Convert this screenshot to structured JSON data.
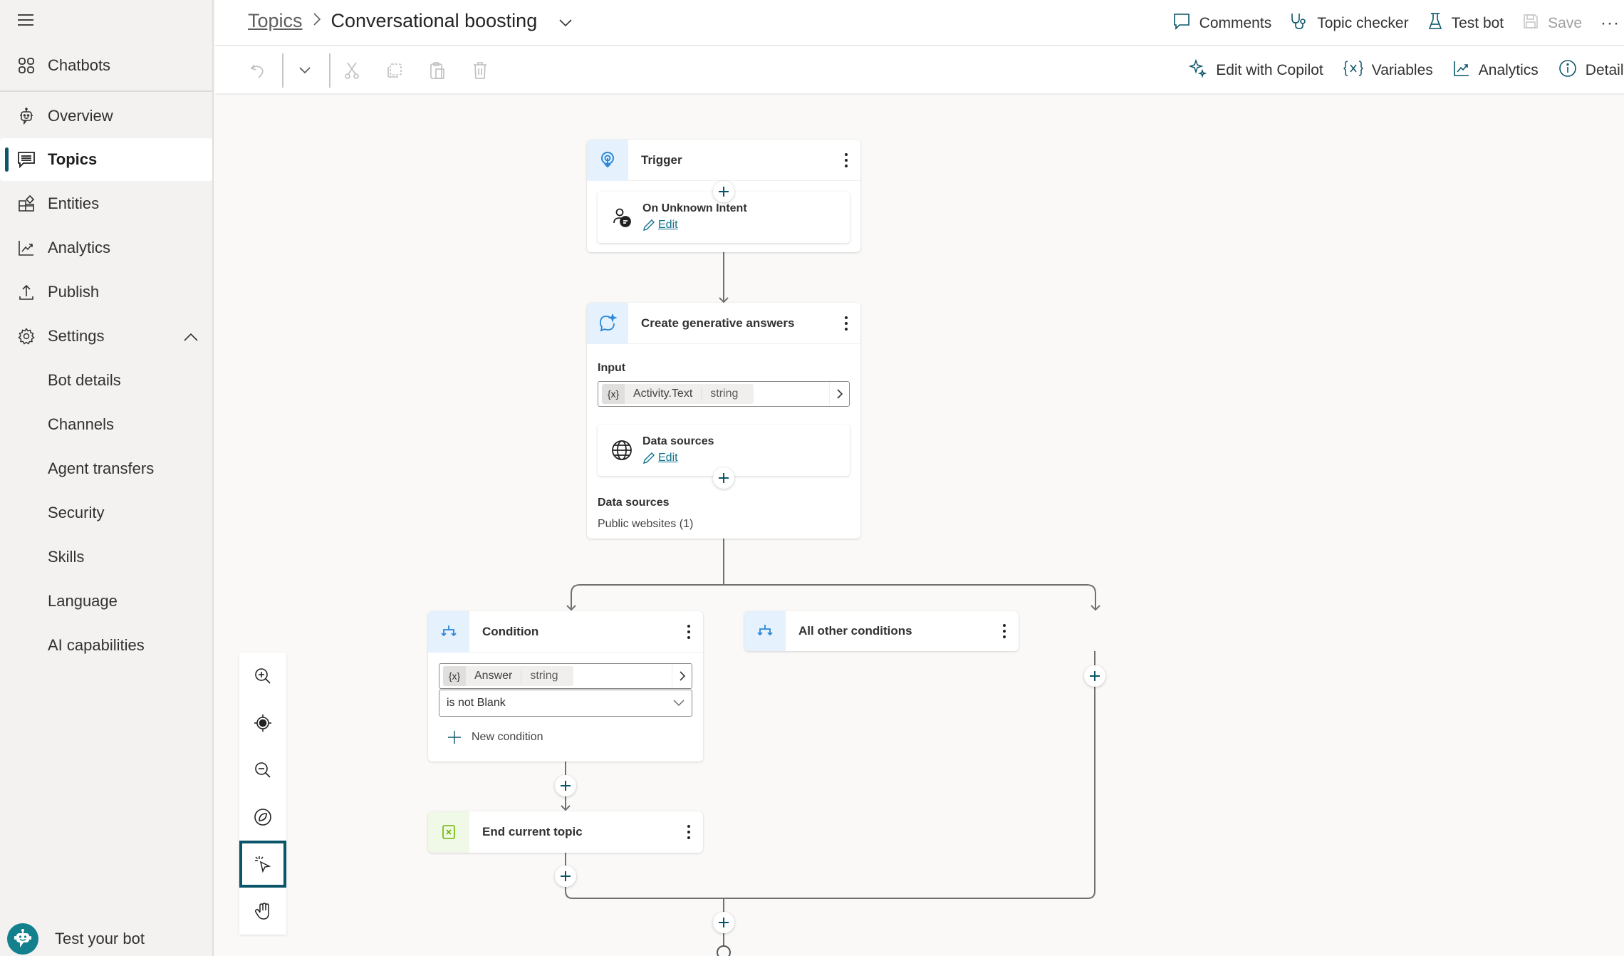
{
  "sidebar": {
    "menu_icon": "hamburger-icon",
    "chatbots": {
      "label": "Chatbots",
      "icon": "grid-icon"
    },
    "items": [
      {
        "label": "Overview",
        "icon": "bot-icon"
      },
      {
        "label": "Topics",
        "icon": "chat-icon",
        "active": true
      },
      {
        "label": "Entities",
        "icon": "entities-icon"
      },
      {
        "label": "Analytics",
        "icon": "chart-icon"
      },
      {
        "label": "Publish",
        "icon": "upload-icon"
      },
      {
        "label": "Settings",
        "icon": "gear-icon",
        "expanded": true
      }
    ],
    "settings_children": [
      {
        "label": "Bot details"
      },
      {
        "label": "Channels"
      },
      {
        "label": "Agent transfers"
      },
      {
        "label": "Security"
      },
      {
        "label": "Skills"
      },
      {
        "label": "Language"
      },
      {
        "label": "AI capabilities"
      }
    ],
    "test_bot": {
      "label": "Test your bot",
      "icon": "bot-avatar-icon"
    }
  },
  "header": {
    "breadcrumb_root": "Topics",
    "title": "Conversational boosting",
    "actions": [
      {
        "label": "Comments",
        "icon": "comment-icon"
      },
      {
        "label": "Topic checker",
        "icon": "stethoscope-icon"
      },
      {
        "label": "Test bot",
        "icon": "flask-icon"
      },
      {
        "label": "Save",
        "icon": "save-icon",
        "disabled": true
      }
    ],
    "more": "···"
  },
  "toolbar": {
    "left_icons": [
      "undo-icon",
      "chevron-down-icon",
      "cut-icon",
      "copy-icon",
      "paste-icon",
      "delete-icon"
    ],
    "right": [
      {
        "label": "Edit with Copilot",
        "icon": "sparkle-icon"
      },
      {
        "label": "Variables",
        "icon": "variable-icon"
      },
      {
        "label": "Analytics",
        "icon": "chart-icon"
      },
      {
        "label": "Details",
        "icon": "info-icon"
      }
    ]
  },
  "canvas": {
    "trigger": {
      "title": "Trigger",
      "sub_title": "On Unknown Intent",
      "edit_label": "Edit"
    },
    "generative": {
      "title": "Create generative answers",
      "input_label": "Input",
      "input_var_icon": "{x}",
      "input_var_name": "Activity.Text",
      "input_var_type": "string",
      "datasources_card_title": "Data sources",
      "edit_label": "Edit",
      "datasources_label": "Data sources",
      "datasources_value": "Public websites (1)"
    },
    "condition": {
      "title": "Condition",
      "var_icon": "{x}",
      "var_name": "Answer",
      "var_type": "string",
      "operator": "is not Blank",
      "new_condition": "New condition"
    },
    "other": {
      "title": "All other conditions"
    },
    "end": {
      "title": "End current topic"
    }
  },
  "canvas_controls": [
    "zoom-in-icon",
    "recenter-icon",
    "zoom-out-icon",
    "minimap-icon",
    "select-mode-icon",
    "pan-mode-icon"
  ],
  "colors": {
    "accent": "#0b556a",
    "link": "#11718a",
    "node_badge": "#e5f1fd",
    "end_badge": "#f0f8e8",
    "bot_avatar": "#13808e"
  }
}
